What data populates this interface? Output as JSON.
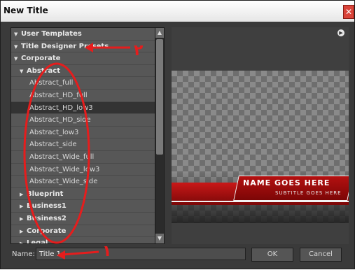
{
  "window": {
    "title": "New Title",
    "close_glyph": "✕"
  },
  "tree": {
    "rows": [
      {
        "label": "User Templates",
        "kind": "folder",
        "expanded": true,
        "level": 0
      },
      {
        "label": "Title Designer Presets",
        "kind": "folder",
        "expanded": true,
        "level": 0
      },
      {
        "label": "Corporate",
        "kind": "folder",
        "expanded": true,
        "level": 1
      },
      {
        "label": "Abstract",
        "kind": "folder",
        "expanded": true,
        "level": 2
      },
      {
        "label": "Abstract_full",
        "kind": "item",
        "level": 3
      },
      {
        "label": "Abstract_HD_full",
        "kind": "item",
        "level": 3
      },
      {
        "label": "Abstract_HD_low3",
        "kind": "item",
        "level": 3,
        "selected": true
      },
      {
        "label": "Abstract_HD_side",
        "kind": "item",
        "level": 3
      },
      {
        "label": "Abstract_low3",
        "kind": "item",
        "level": 3
      },
      {
        "label": "Abstract_side",
        "kind": "item",
        "level": 3
      },
      {
        "label": "Abstract_Wide_full",
        "kind": "item",
        "level": 3
      },
      {
        "label": "Abstract_Wide_low3",
        "kind": "item",
        "level": 3
      },
      {
        "label": "Abstract_Wide_side",
        "kind": "item",
        "level": 3
      },
      {
        "label": "Blueprint",
        "kind": "folder",
        "expanded": false,
        "level": 2
      },
      {
        "label": "Business1",
        "kind": "folder",
        "expanded": false,
        "level": 2
      },
      {
        "label": "Business2",
        "kind": "folder",
        "expanded": false,
        "level": 2
      },
      {
        "label": "Corporate",
        "kind": "folder",
        "expanded": false,
        "level": 2
      },
      {
        "label": "Legal",
        "kind": "folder",
        "expanded": false,
        "level": 2
      }
    ]
  },
  "preview": {
    "name_text": "NAME GOES HERE",
    "subtitle_text": "SUBTITLE GOES HERE",
    "menu_icon": "circle-arrow-icon"
  },
  "form": {
    "name_label": "Name:",
    "name_value": "Title 1",
    "ok_label": "OK",
    "cancel_label": "Cancel"
  },
  "annotations": {
    "mark_1": "١",
    "mark_2": "٢",
    "color": "#e51d1d"
  }
}
